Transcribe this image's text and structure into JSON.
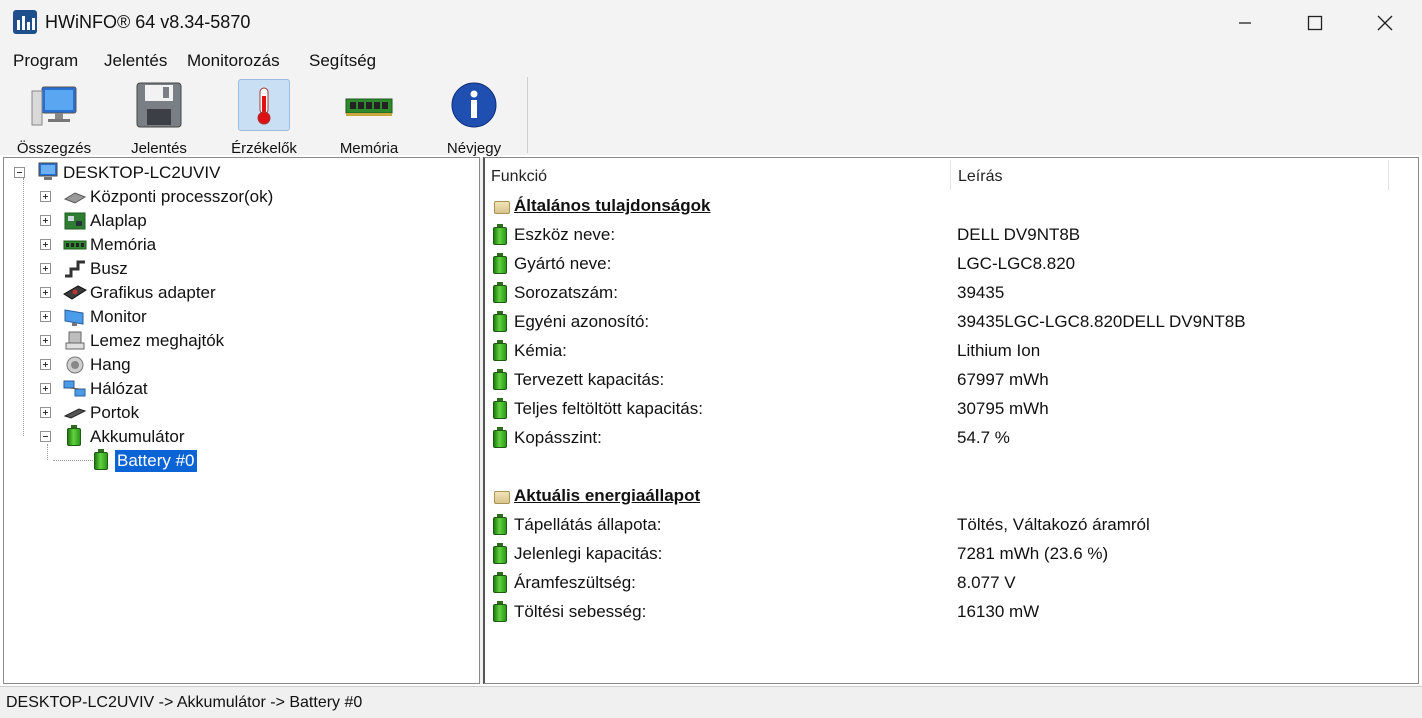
{
  "window": {
    "title": "HWiNFO® 64 v8.34-5870"
  },
  "menu": [
    "Program",
    "Jelentés",
    "Monitorozás",
    "Segítség"
  ],
  "toolbar": [
    {
      "label": "Összegzés",
      "icon": "monitor-icon"
    },
    {
      "label": "Jelentés",
      "icon": "floppy-disk-icon"
    },
    {
      "label": "Érzékelők",
      "icon": "thermometer-icon",
      "active": true
    },
    {
      "label": "Memória",
      "icon": "memory-module-icon"
    },
    {
      "label": "Névjegy",
      "icon": "info-icon"
    }
  ],
  "tree": {
    "root": "DESKTOP-LC2UVIV",
    "items": [
      {
        "label": "Központi processzor(ok)",
        "icon": "cpu-icon"
      },
      {
        "label": "Alaplap",
        "icon": "motherboard-icon"
      },
      {
        "label": "Memória",
        "icon": "memory-icon"
      },
      {
        "label": "Busz",
        "icon": "bus-icon"
      },
      {
        "label": "Grafikus adapter",
        "icon": "graphics-card-icon"
      },
      {
        "label": "Monitor",
        "icon": "monitor-icon"
      },
      {
        "label": "Lemez meghajtók",
        "icon": "disk-drive-icon"
      },
      {
        "label": "Hang",
        "icon": "speaker-icon"
      },
      {
        "label": "Hálózat",
        "icon": "network-icon"
      },
      {
        "label": "Portok",
        "icon": "ports-icon"
      },
      {
        "label": "Akkumulátor",
        "icon": "battery-icon",
        "expanded": true
      }
    ],
    "child": "Battery #0"
  },
  "details": {
    "col_function": "Funkció",
    "col_description": "Leírás",
    "rows": [
      {
        "type": "section",
        "label": "Általános tulajdonságok",
        "value": ""
      },
      {
        "type": "item",
        "label": "Eszköz neve:",
        "value": "DELL DV9NT8B"
      },
      {
        "type": "item",
        "label": "Gyártó neve:",
        "value": "LGC-LGC8.820"
      },
      {
        "type": "item",
        "label": "Sorozatszám:",
        "value": "39435"
      },
      {
        "type": "item",
        "label": "Egyéni azonosító:",
        "value": "39435LGC-LGC8.820DELL DV9NT8B"
      },
      {
        "type": "item",
        "label": "Kémia:",
        "value": "Lithium Ion"
      },
      {
        "type": "item",
        "label": "Tervezett kapacitás:",
        "value": "67997 mWh"
      },
      {
        "type": "item",
        "label": "Teljes feltöltött kapacitás:",
        "value": "30795 mWh"
      },
      {
        "type": "item",
        "label": "Kopásszint:",
        "value": "54.7 %"
      },
      {
        "type": "blank",
        "label": "",
        "value": ""
      },
      {
        "type": "section",
        "label": "Aktuális energiaállapot",
        "value": ""
      },
      {
        "type": "item",
        "label": "Tápellátás állapota:",
        "value": "Töltés, Váltakozó áramról"
      },
      {
        "type": "item",
        "label": "Jelenlegi kapacitás:",
        "value": "7281 mWh (23.6 %)"
      },
      {
        "type": "item",
        "label": "Áramfeszültség:",
        "value": "8.077 V"
      },
      {
        "type": "item",
        "label": "Töltési sebesség:",
        "value": "16130 mW"
      }
    ]
  },
  "status": "DESKTOP-LC2UVIV -> Akkumulátor -> Battery #0",
  "colors": {
    "selection": "#0a64d6",
    "battery_green": "#3cb521",
    "chrome": "#f3f3f3"
  }
}
